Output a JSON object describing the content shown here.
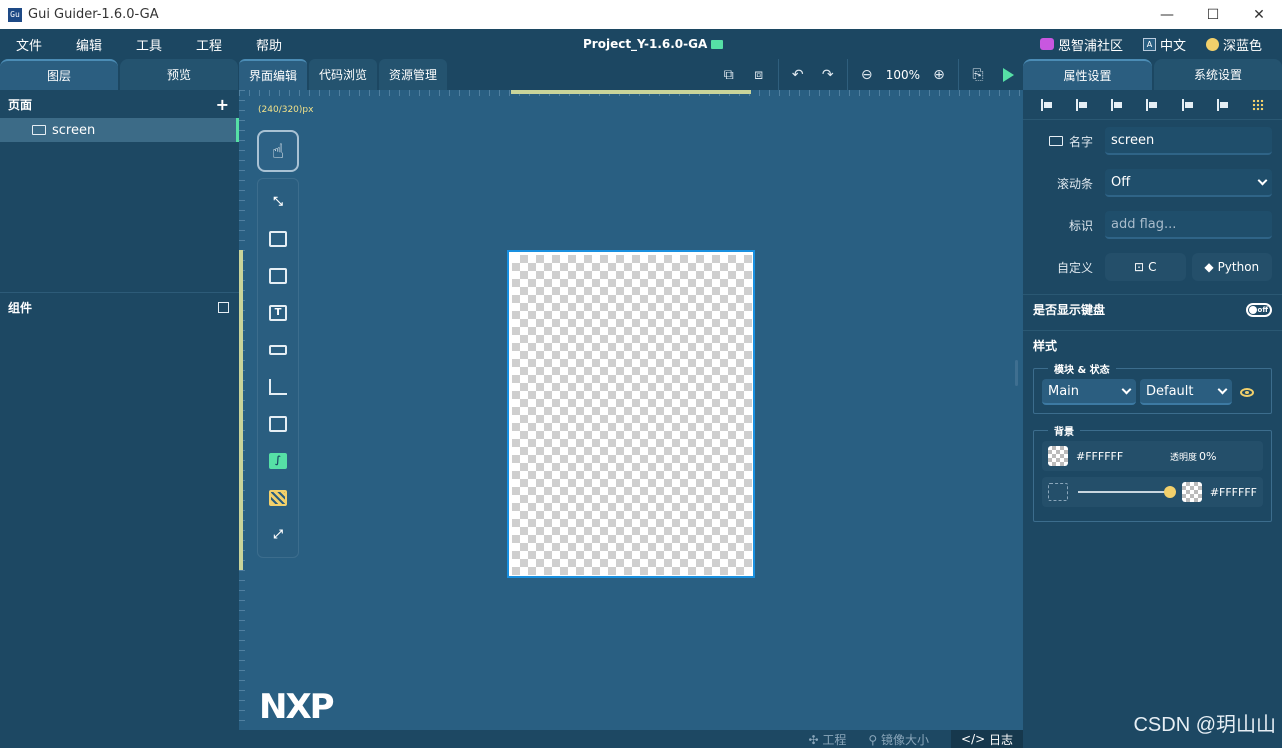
{
  "window": {
    "title": "Gui Guider-1.6.0-GA",
    "logo": "Gu",
    "controls": [
      "—",
      "☐",
      "✕"
    ]
  },
  "menubar": {
    "items": [
      "文件",
      "编辑",
      "工具",
      "工程",
      "帮助"
    ],
    "project": "Project_Y-1.6.0-GA",
    "community": "恩智浦社区",
    "language": "中文",
    "theme": "深蓝色"
  },
  "left": {
    "tabs": [
      "图层",
      "预览"
    ],
    "pages_header": "页面",
    "add_symbol": "+",
    "tree_item": "screen",
    "components_header": "组件"
  },
  "center": {
    "tabs": [
      "界面编辑",
      "代码浏览",
      "资源管理"
    ],
    "zoom": "100%",
    "size_label": "(240/320)px",
    "logo": "NXP",
    "toolbar_icons": [
      "bring-front-icon",
      "send-back-icon",
      "undo-icon",
      "redo-icon",
      "zoom-out-icon",
      "zoom-in-icon",
      "export-icon",
      "run-icon"
    ],
    "widgets": [
      "collapse-icon",
      "button-widget-icon",
      "imgbtn-widget-icon",
      "label-widget-icon",
      "textbox-widget-icon",
      "chart-widget-icon",
      "image-widget-icon",
      "curve-widget-icon",
      "qrcode-widget-icon",
      "expand-icon"
    ],
    "label_widget_glyph": "T"
  },
  "statusbar": {
    "project": "工程",
    "mirror_size": "镜像大小",
    "log": "日志"
  },
  "right": {
    "tabs": [
      "属性设置",
      "系统设置"
    ],
    "name_label": "名字",
    "name_value": "screen",
    "scrollbar_label": "滚动条",
    "scrollbar_value": "Off",
    "flag_label": "标识",
    "flag_placeholder": "add flag...",
    "custom_label": "自定义",
    "custom_c": "C",
    "custom_python": "Python",
    "keyboard_label": "是否显示键盘",
    "keyboard_toggle": "off",
    "style_header": "样式",
    "part_state_title": "模块 & 状态",
    "part_value": "Main",
    "state_value": "Default",
    "background_title": "背景",
    "bg_color": "#FFFFFF",
    "opacity_label": "透明度",
    "opacity_value": "0%",
    "grad_color": "#FFFFFF"
  },
  "watermark": "CSDN @玥山山",
  "colors": {
    "accent_green": "#56e0a6",
    "highlight_yellow": "#f2d06b",
    "selection_blue": "#1990e0",
    "panel_bg": "#1d4863",
    "canvas_bg": "#295f82"
  }
}
